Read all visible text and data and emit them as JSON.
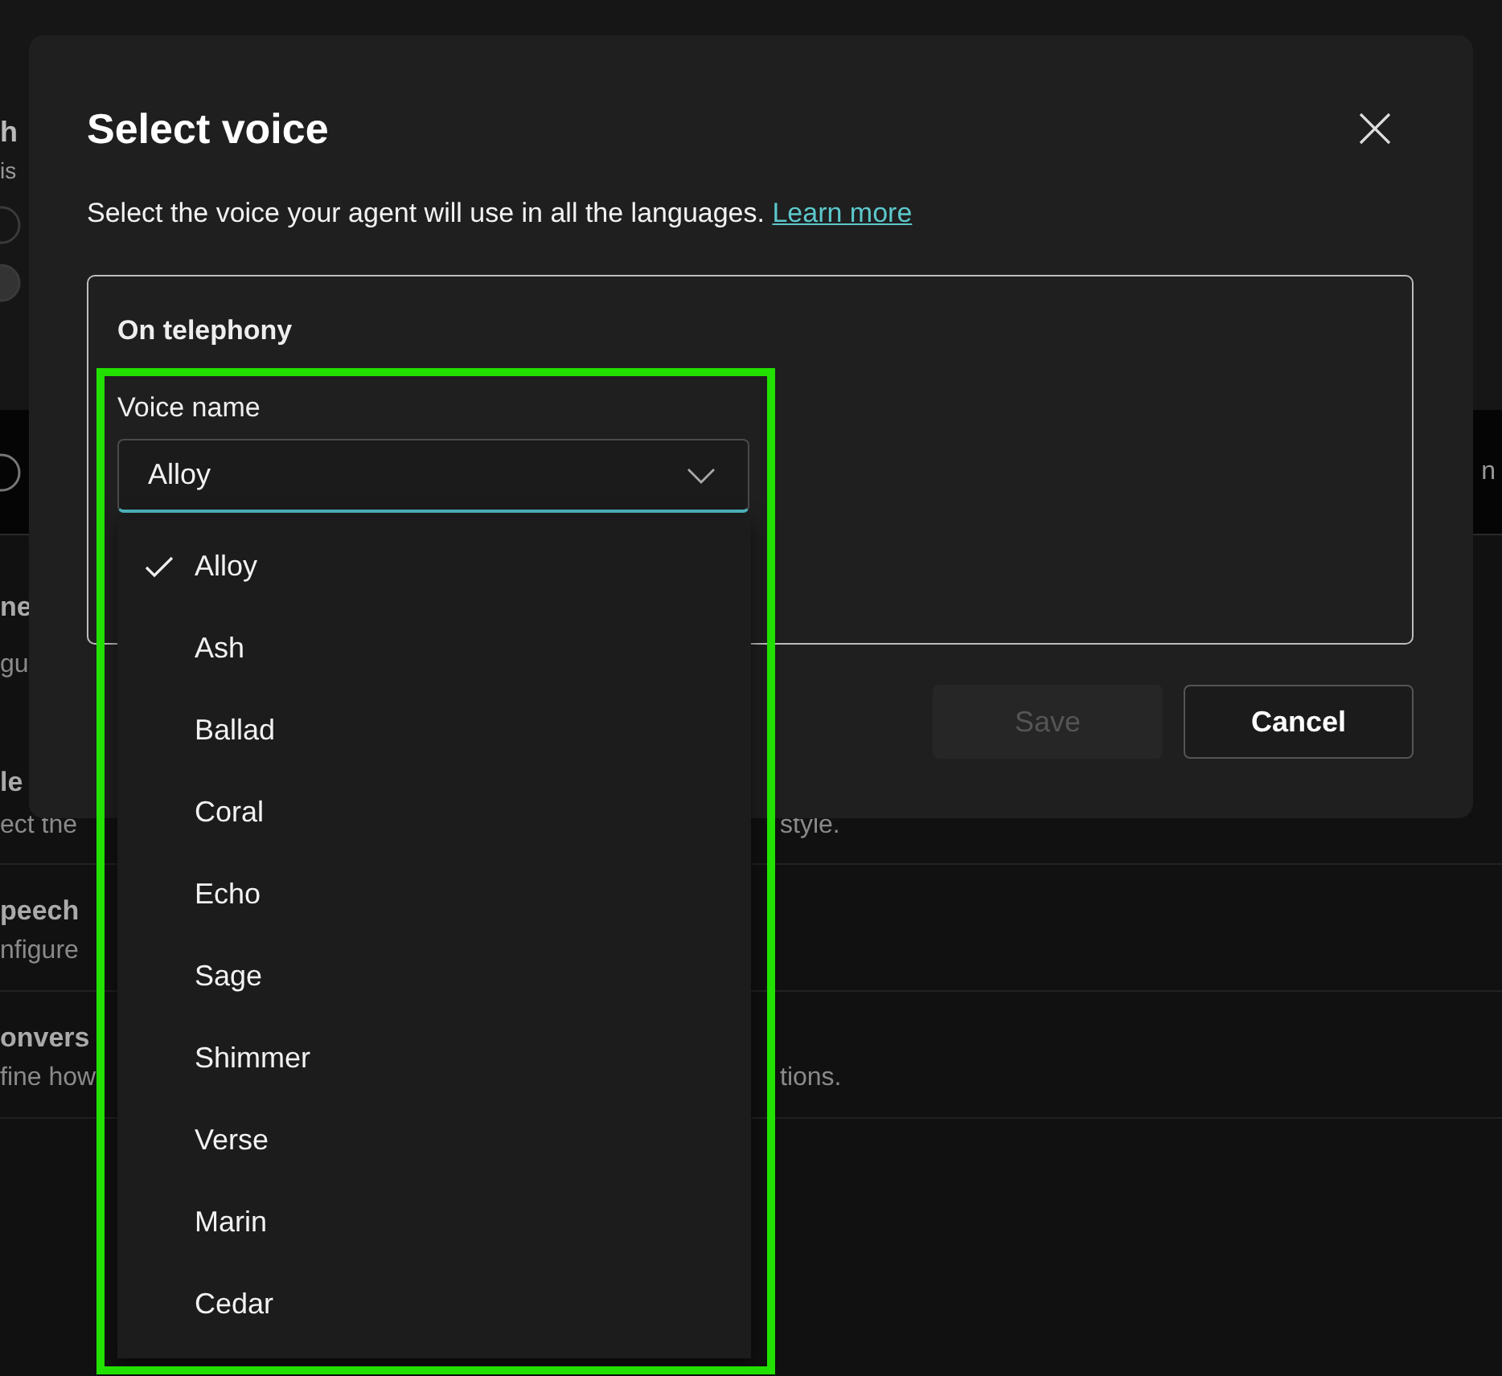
{
  "background": {
    "header": {
      "title_fragment": "h",
      "subtitle_fragment": "is"
    },
    "band": {
      "text_fragment": "n"
    },
    "settings": [
      {
        "title_fragment": "ne",
        "description_fragment": "gu"
      },
      {
        "title_fragment": "le",
        "description_fragment": "ect the",
        "description_tail": "style."
      },
      {
        "title_fragment": "peech",
        "description_fragment": "nfigure"
      },
      {
        "title_fragment": "onvers",
        "description_fragment": "fine how",
        "description_tail": "tions."
      }
    ]
  },
  "dialog": {
    "title": "Select voice",
    "description": "Select the voice your agent will use in all the languages.",
    "link": "Learn more",
    "section": {
      "title": "On telephony",
      "field_label": "Voice name",
      "value": "Alloy",
      "expanded": true
    },
    "options": [
      {
        "label": "Alloy",
        "selected": true
      },
      {
        "label": "Ash",
        "selected": false
      },
      {
        "label": "Ballad",
        "selected": false
      },
      {
        "label": "Coral",
        "selected": false
      },
      {
        "label": "Echo",
        "selected": false
      },
      {
        "label": "Sage",
        "selected": false
      },
      {
        "label": "Shimmer",
        "selected": false
      },
      {
        "label": "Verse",
        "selected": false
      },
      {
        "label": "Marin",
        "selected": false
      },
      {
        "label": "Cedar",
        "selected": false
      }
    ],
    "buttons": [
      {
        "label": "Save",
        "disabled": true
      },
      {
        "label": "Cancel",
        "disabled": false
      }
    ]
  },
  "highlight": {
    "shown": true
  }
}
